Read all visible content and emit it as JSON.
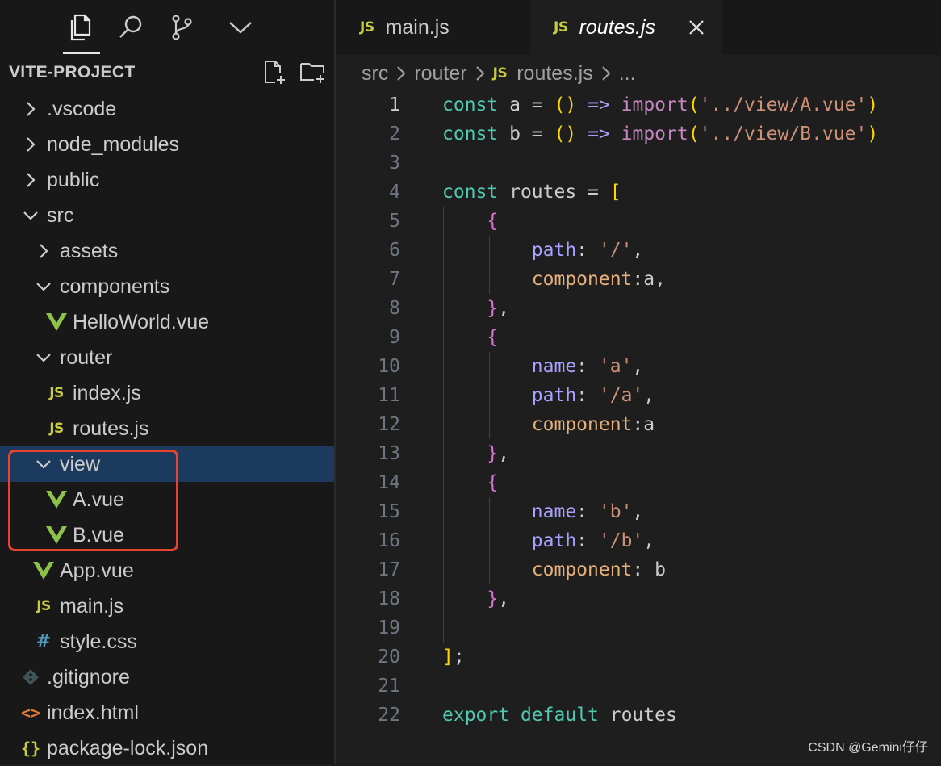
{
  "explorer": {
    "title": "VITE-PROJECT",
    "tree": [
      {
        "label": ".vscode",
        "kind": "folder-closed",
        "depth": 0
      },
      {
        "label": "node_modules",
        "kind": "folder-closed",
        "depth": 0
      },
      {
        "label": "public",
        "kind": "folder-closed",
        "depth": 0
      },
      {
        "label": "src",
        "kind": "folder-open",
        "depth": 0
      },
      {
        "label": "assets",
        "kind": "folder-closed",
        "depth": 1
      },
      {
        "label": "components",
        "kind": "folder-open",
        "depth": 1
      },
      {
        "label": "HelloWorld.vue",
        "kind": "vue",
        "depth": 2
      },
      {
        "label": "router",
        "kind": "folder-open",
        "depth": 1
      },
      {
        "label": "index.js",
        "kind": "js",
        "depth": 2
      },
      {
        "label": "routes.js",
        "kind": "js",
        "depth": 2
      },
      {
        "label": "view",
        "kind": "folder-open",
        "depth": 1,
        "selected": true
      },
      {
        "label": "A.vue",
        "kind": "vue",
        "depth": 2
      },
      {
        "label": "B.vue",
        "kind": "vue",
        "depth": 2
      },
      {
        "label": "App.vue",
        "kind": "vue",
        "depth": 1
      },
      {
        "label": "main.js",
        "kind": "js",
        "depth": 1
      },
      {
        "label": "style.css",
        "kind": "css",
        "depth": 1
      },
      {
        "label": ".gitignore",
        "kind": "git",
        "depth": 0
      },
      {
        "label": "index.html",
        "kind": "html",
        "depth": 0
      },
      {
        "label": "package-lock.json",
        "kind": "json",
        "depth": 0
      }
    ]
  },
  "icons": {
    "js": "JS",
    "css": "#",
    "html": "<>",
    "json": "{}"
  },
  "tabs": [
    {
      "label": "main.js",
      "active": false
    },
    {
      "label": "routes.js",
      "active": true
    }
  ],
  "breadcrumb": [
    "src",
    "router",
    "routes.js",
    "..."
  ],
  "editor": {
    "lines": [
      [
        [
          "k",
          "const"
        ],
        [
          "v",
          " a "
        ],
        [
          "op",
          "="
        ],
        [
          "v",
          " "
        ],
        [
          "p1",
          "()"
        ],
        [
          "v",
          " "
        ],
        [
          "arrow",
          "=>"
        ],
        [
          "v",
          " "
        ],
        [
          "imp",
          "import"
        ],
        [
          "p1",
          "("
        ],
        [
          "s",
          "'../view/A.vue'"
        ],
        [
          "p1",
          ")"
        ]
      ],
      [
        [
          "k",
          "const"
        ],
        [
          "v",
          " b "
        ],
        [
          "op",
          "="
        ],
        [
          "v",
          " "
        ],
        [
          "p1",
          "()"
        ],
        [
          "v",
          " "
        ],
        [
          "arrow",
          "=>"
        ],
        [
          "v",
          " "
        ],
        [
          "imp",
          "import"
        ],
        [
          "p1",
          "("
        ],
        [
          "s",
          "'../view/B.vue'"
        ],
        [
          "p1",
          ")"
        ]
      ],
      [],
      [
        [
          "k",
          "const"
        ],
        [
          "v",
          " routes "
        ],
        [
          "op",
          "="
        ],
        [
          "v",
          " "
        ],
        [
          "p1",
          "["
        ]
      ],
      [
        [
          "v",
          "    "
        ],
        [
          "p2",
          "{"
        ]
      ],
      [
        [
          "v",
          "        "
        ],
        [
          "prop",
          "path"
        ],
        [
          "punc",
          ": "
        ],
        [
          "s",
          "'/'"
        ],
        [
          "punc",
          ","
        ]
      ],
      [
        [
          "v",
          "        "
        ],
        [
          "prop2",
          "component"
        ],
        [
          "punc",
          ":"
        ],
        [
          "v",
          "a"
        ],
        [
          "punc",
          ","
        ]
      ],
      [
        [
          "v",
          "    "
        ],
        [
          "p2",
          "}"
        ],
        [
          "punc",
          ","
        ]
      ],
      [
        [
          "v",
          "    "
        ],
        [
          "p2",
          "{"
        ]
      ],
      [
        [
          "v",
          "        "
        ],
        [
          "prop",
          "name"
        ],
        [
          "punc",
          ": "
        ],
        [
          "s",
          "'a'"
        ],
        [
          "punc",
          ","
        ]
      ],
      [
        [
          "v",
          "        "
        ],
        [
          "prop",
          "path"
        ],
        [
          "punc",
          ": "
        ],
        [
          "s",
          "'/a'"
        ],
        [
          "punc",
          ","
        ]
      ],
      [
        [
          "v",
          "        "
        ],
        [
          "prop2",
          "component"
        ],
        [
          "punc",
          ":"
        ],
        [
          "v",
          "a"
        ]
      ],
      [
        [
          "v",
          "    "
        ],
        [
          "p2",
          "}"
        ],
        [
          "punc",
          ","
        ]
      ],
      [
        [
          "v",
          "    "
        ],
        [
          "p2",
          "{"
        ]
      ],
      [
        [
          "v",
          "        "
        ],
        [
          "prop",
          "name"
        ],
        [
          "punc",
          ": "
        ],
        [
          "s",
          "'b'"
        ],
        [
          "punc",
          ","
        ]
      ],
      [
        [
          "v",
          "        "
        ],
        [
          "prop",
          "path"
        ],
        [
          "punc",
          ": "
        ],
        [
          "s",
          "'/b'"
        ],
        [
          "punc",
          ","
        ]
      ],
      [
        [
          "v",
          "        "
        ],
        [
          "prop2",
          "component"
        ],
        [
          "punc",
          ": "
        ],
        [
          "v",
          "b"
        ]
      ],
      [
        [
          "v",
          "    "
        ],
        [
          "p2",
          "}"
        ],
        [
          "punc",
          ","
        ]
      ],
      [],
      [
        [
          "p1",
          "]"
        ],
        [
          "punc",
          ";"
        ]
      ],
      [],
      [
        [
          "k",
          "export"
        ],
        [
          "v",
          " "
        ],
        [
          "k",
          "default"
        ],
        [
          "v",
          " routes"
        ]
      ]
    ],
    "active_line": 1
  },
  "watermark": "CSDN @Gemini仔仔",
  "colors": {
    "selection": "#1c3a5e",
    "highlight_box": "#e8432e",
    "vue_green": "#8dc149",
    "js_yellow": "#cbcb41"
  }
}
